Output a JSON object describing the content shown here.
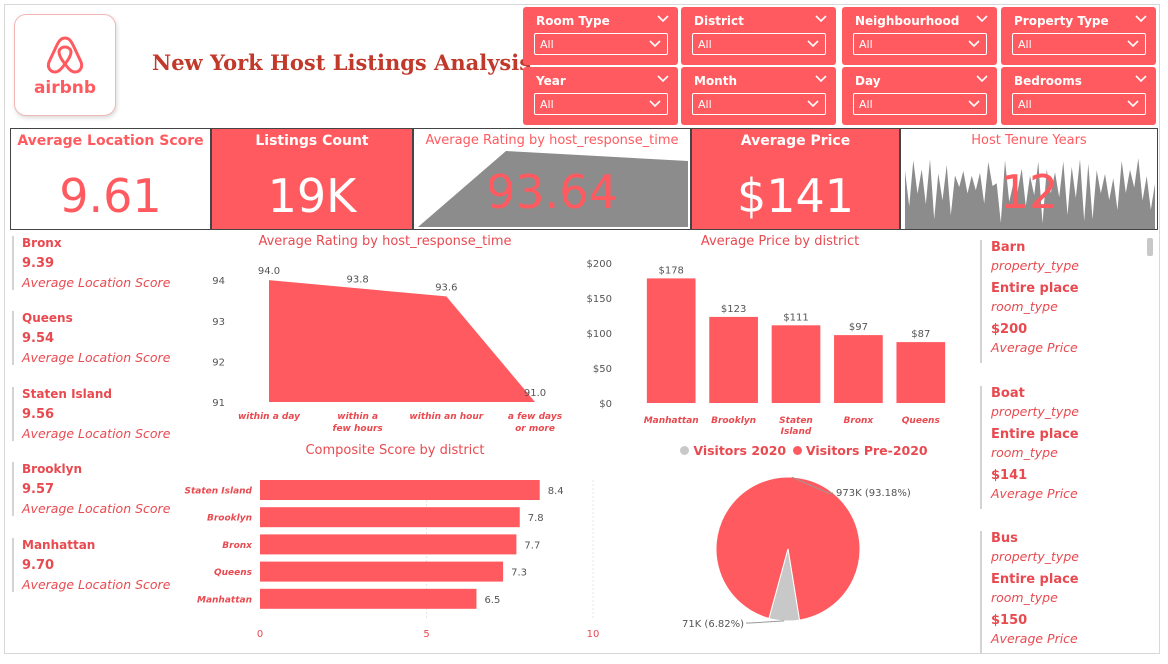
{
  "brand": {
    "logo_text": "airbnb",
    "primary_color": "#ff5a5f",
    "title_color": "#c0392b"
  },
  "title": "New York Host Listings Analysis",
  "slicers": [
    {
      "label": "Room Type",
      "value": "All"
    },
    {
      "label": "District",
      "value": "All"
    },
    {
      "label": "Neighbourhood",
      "value": "All"
    },
    {
      "label": "Property Type",
      "value": "All"
    },
    {
      "label": "Year",
      "value": "All"
    },
    {
      "label": "Month",
      "value": "All"
    },
    {
      "label": "Day",
      "value": "All"
    },
    {
      "label": "Bedrooms",
      "value": "All"
    }
  ],
  "kpis": {
    "location_score": {
      "title": "Average Location Score",
      "value": "9.61"
    },
    "listings": {
      "title": "Listings Count",
      "value": "19K"
    },
    "rating": {
      "title": "Average Rating by host_response_time",
      "value": "93.64"
    },
    "price": {
      "title": "Average Price",
      "value": "$141"
    },
    "tenure": {
      "title": "Host Tenure Years",
      "value": "12"
    }
  },
  "location_list": [
    {
      "name": "Bronx",
      "value": "9.39",
      "label": "Average Location Score"
    },
    {
      "name": "Queens",
      "value": "9.54",
      "label": "Average Location Score"
    },
    {
      "name": "Staten Island",
      "value": "9.56",
      "label": "Average Location Score"
    },
    {
      "name": "Brooklyn",
      "value": "9.57",
      "label": "Average Location Score"
    },
    {
      "name": "Manhattan",
      "value": "9.70",
      "label": "Average Location Score"
    }
  ],
  "property_list": [
    {
      "property": "Barn",
      "property_label": "property_type",
      "room": "Entire place",
      "room_label": "room_type",
      "price": "$200",
      "price_label": "Average Price"
    },
    {
      "property": "Boat",
      "property_label": "property_type",
      "room": "Entire place",
      "room_label": "room_type",
      "price": "$141",
      "price_label": "Average Price"
    },
    {
      "property": "Bus",
      "property_label": "property_type",
      "room": "Entire place",
      "room_label": "room_type",
      "price": "$150",
      "price_label": "Average Price"
    }
  ],
  "chart_data": [
    {
      "type": "area",
      "title": "Average Rating by host_response_time",
      "categories": [
        "within a day",
        "within a few hours",
        "within an hour",
        "a few days or more"
      ],
      "values": [
        94.0,
        93.8,
        93.6,
        91.0
      ],
      "data_labels": [
        "94.0",
        "93.8",
        "93.6",
        "91.0"
      ],
      "yticks": [
        "91",
        "92",
        "93",
        "94"
      ],
      "ylim": [
        91,
        94.3
      ]
    },
    {
      "type": "bar",
      "title": "Average Price by district",
      "categories": [
        "Manhattan",
        "Brooklyn",
        "Staten Island",
        "Bronx",
        "Queens"
      ],
      "values": [
        178,
        123,
        111,
        97,
        87
      ],
      "data_labels": [
        "$178",
        "$123",
        "$111",
        "$97",
        "$87"
      ],
      "yticks": [
        "$0",
        "$50",
        "$100",
        "$150",
        "$200"
      ],
      "ylim": [
        0,
        200
      ]
    },
    {
      "type": "bar",
      "orientation": "horizontal",
      "title": "Composite Score by district",
      "categories": [
        "Staten Island",
        "Brooklyn",
        "Bronx",
        "Queens",
        "Manhattan"
      ],
      "values": [
        8.4,
        7.8,
        7.7,
        7.3,
        6.5
      ],
      "data_labels": [
        "8.4",
        "7.8",
        "7.7",
        "7.3",
        "6.5"
      ],
      "xticks": [
        "0",
        "5",
        "10"
      ],
      "xlim": [
        0,
        10
      ]
    },
    {
      "type": "pie",
      "legend": [
        "Visitors 2020",
        "Visitors Pre-2020"
      ],
      "legend_colors": [
        "#c8c8c8",
        "#ff5a5f"
      ],
      "slices": [
        {
          "name": "Visitors Pre-2020",
          "value": 973000,
          "label": "973K (93.18%)",
          "color": "#ff5a5f"
        },
        {
          "name": "Visitors 2020",
          "value": 71000,
          "label": "71K (6.82%)",
          "color": "#c8c8c8"
        }
      ]
    }
  ]
}
